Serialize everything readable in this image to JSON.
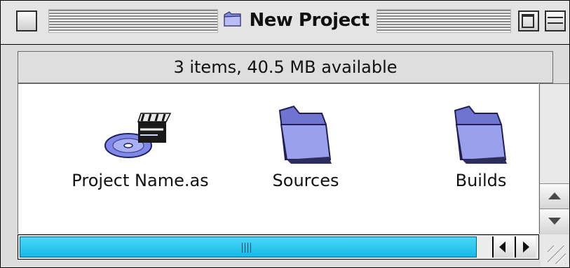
{
  "window": {
    "title": "New Project",
    "title_icon": "folder-icon",
    "status": "3 items, 40.5 MB available"
  },
  "items": [
    {
      "name": "Project Name.as",
      "icon": "cd-clapperboard-icon"
    },
    {
      "name": "Sources",
      "icon": "folder-icon"
    },
    {
      "name": "Builds",
      "icon": "folder-icon"
    }
  ],
  "colors": {
    "scroll_thumb": "#14b8e8",
    "folder": "#8f95e6"
  }
}
